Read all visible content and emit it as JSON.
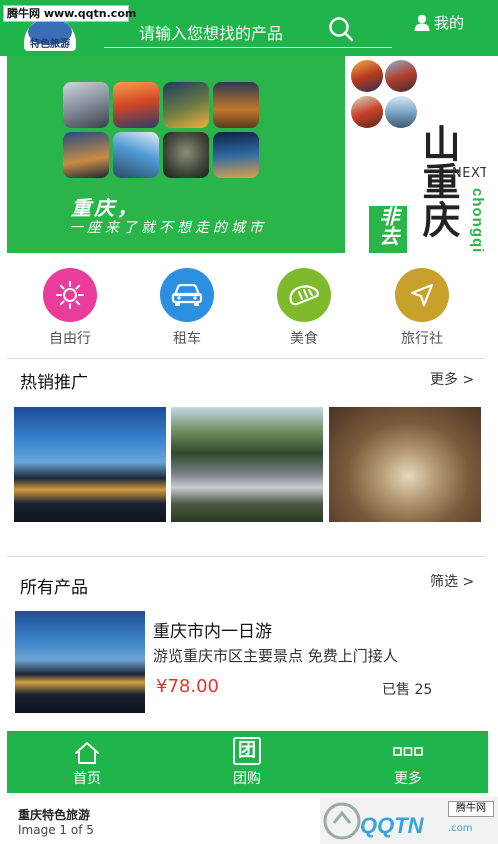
{
  "watermark": {
    "top_text": "腾牛网 www.qqtn.com",
    "bottom_badge": "腾牛网",
    "bottom_logo": "QQTN",
    "bottom_logo_sub": ".com"
  },
  "header": {
    "logo_text": "特色旅游",
    "search_placeholder": "请输入您想找的产品",
    "account_label": "我的",
    "bg_color": "#1fb54a"
  },
  "banner": {
    "slogan_title": "重庆，",
    "slogan_sub": "一座来了就不想走的城市",
    "next_label": "NEXT",
    "big_title": "山重庆",
    "vertical_text": "非去不可",
    "english_title": "chongqing"
  },
  "categories": [
    {
      "label": "自由行",
      "icon": "sun-icon",
      "color": "#ea3c9a"
    },
    {
      "label": "租车",
      "icon": "car-icon",
      "color": "#2d8fe0"
    },
    {
      "label": "美食",
      "icon": "bread-icon",
      "color": "#7fba2d"
    },
    {
      "label": "旅行社",
      "icon": "navigation-arrow-icon",
      "color": "#c8a12c"
    }
  ],
  "hot_section": {
    "title": "热销推广",
    "more_label": "更多 >"
  },
  "products_section": {
    "title": "所有产品",
    "filter_label": "筛选 >"
  },
  "product": {
    "title": "重庆市内一日游",
    "description": "游览重庆市区主要景点 免费上门接人",
    "price": "¥78.00",
    "sold": "已售 25"
  },
  "bottom_nav": [
    {
      "label": "首页",
      "icon": "home-icon"
    },
    {
      "label": "团购",
      "icon": "group-buy-icon",
      "icon_text": "团"
    },
    {
      "label": "更多",
      "icon": "more-dots-icon"
    }
  ],
  "footer": {
    "title": "重庆特色旅游",
    "image_count": "Image 1 of 5"
  }
}
